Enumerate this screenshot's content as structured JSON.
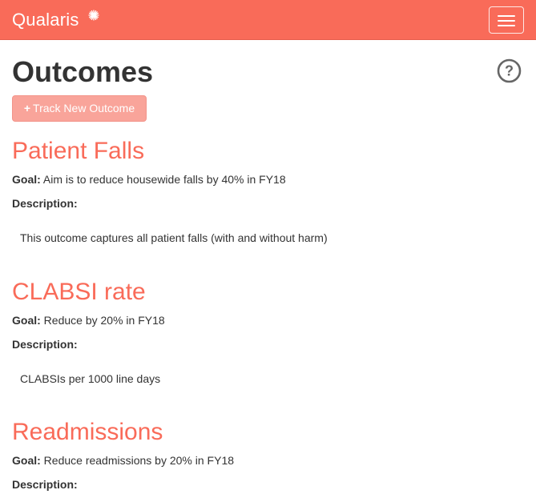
{
  "app": {
    "brand": "Qualaris"
  },
  "page": {
    "title": "Outcomes",
    "track_button_label": "Track New Outcome"
  },
  "labels": {
    "goal": "Goal:",
    "description": "Description:"
  },
  "outcomes": [
    {
      "title": "Patient Falls",
      "goal": "Aim is to reduce housewide falls by 40% in FY18",
      "description": "This outcome captures all patient falls (with and without harm)"
    },
    {
      "title": "CLABSI rate",
      "goal": "Reduce by 20% in FY18",
      "description": "CLABSIs per 1000 line days"
    },
    {
      "title": "Readmissions",
      "goal": "Reduce readmissions by 20% in FY18",
      "description": ""
    }
  ],
  "colors": {
    "brand": "#f96b59",
    "button": "#f9a49a"
  },
  "icons": {
    "brand_mark": "sunburst-icon",
    "menu": "hamburger-menu-icon",
    "help": "question-circle-icon",
    "add": "plus-icon"
  }
}
